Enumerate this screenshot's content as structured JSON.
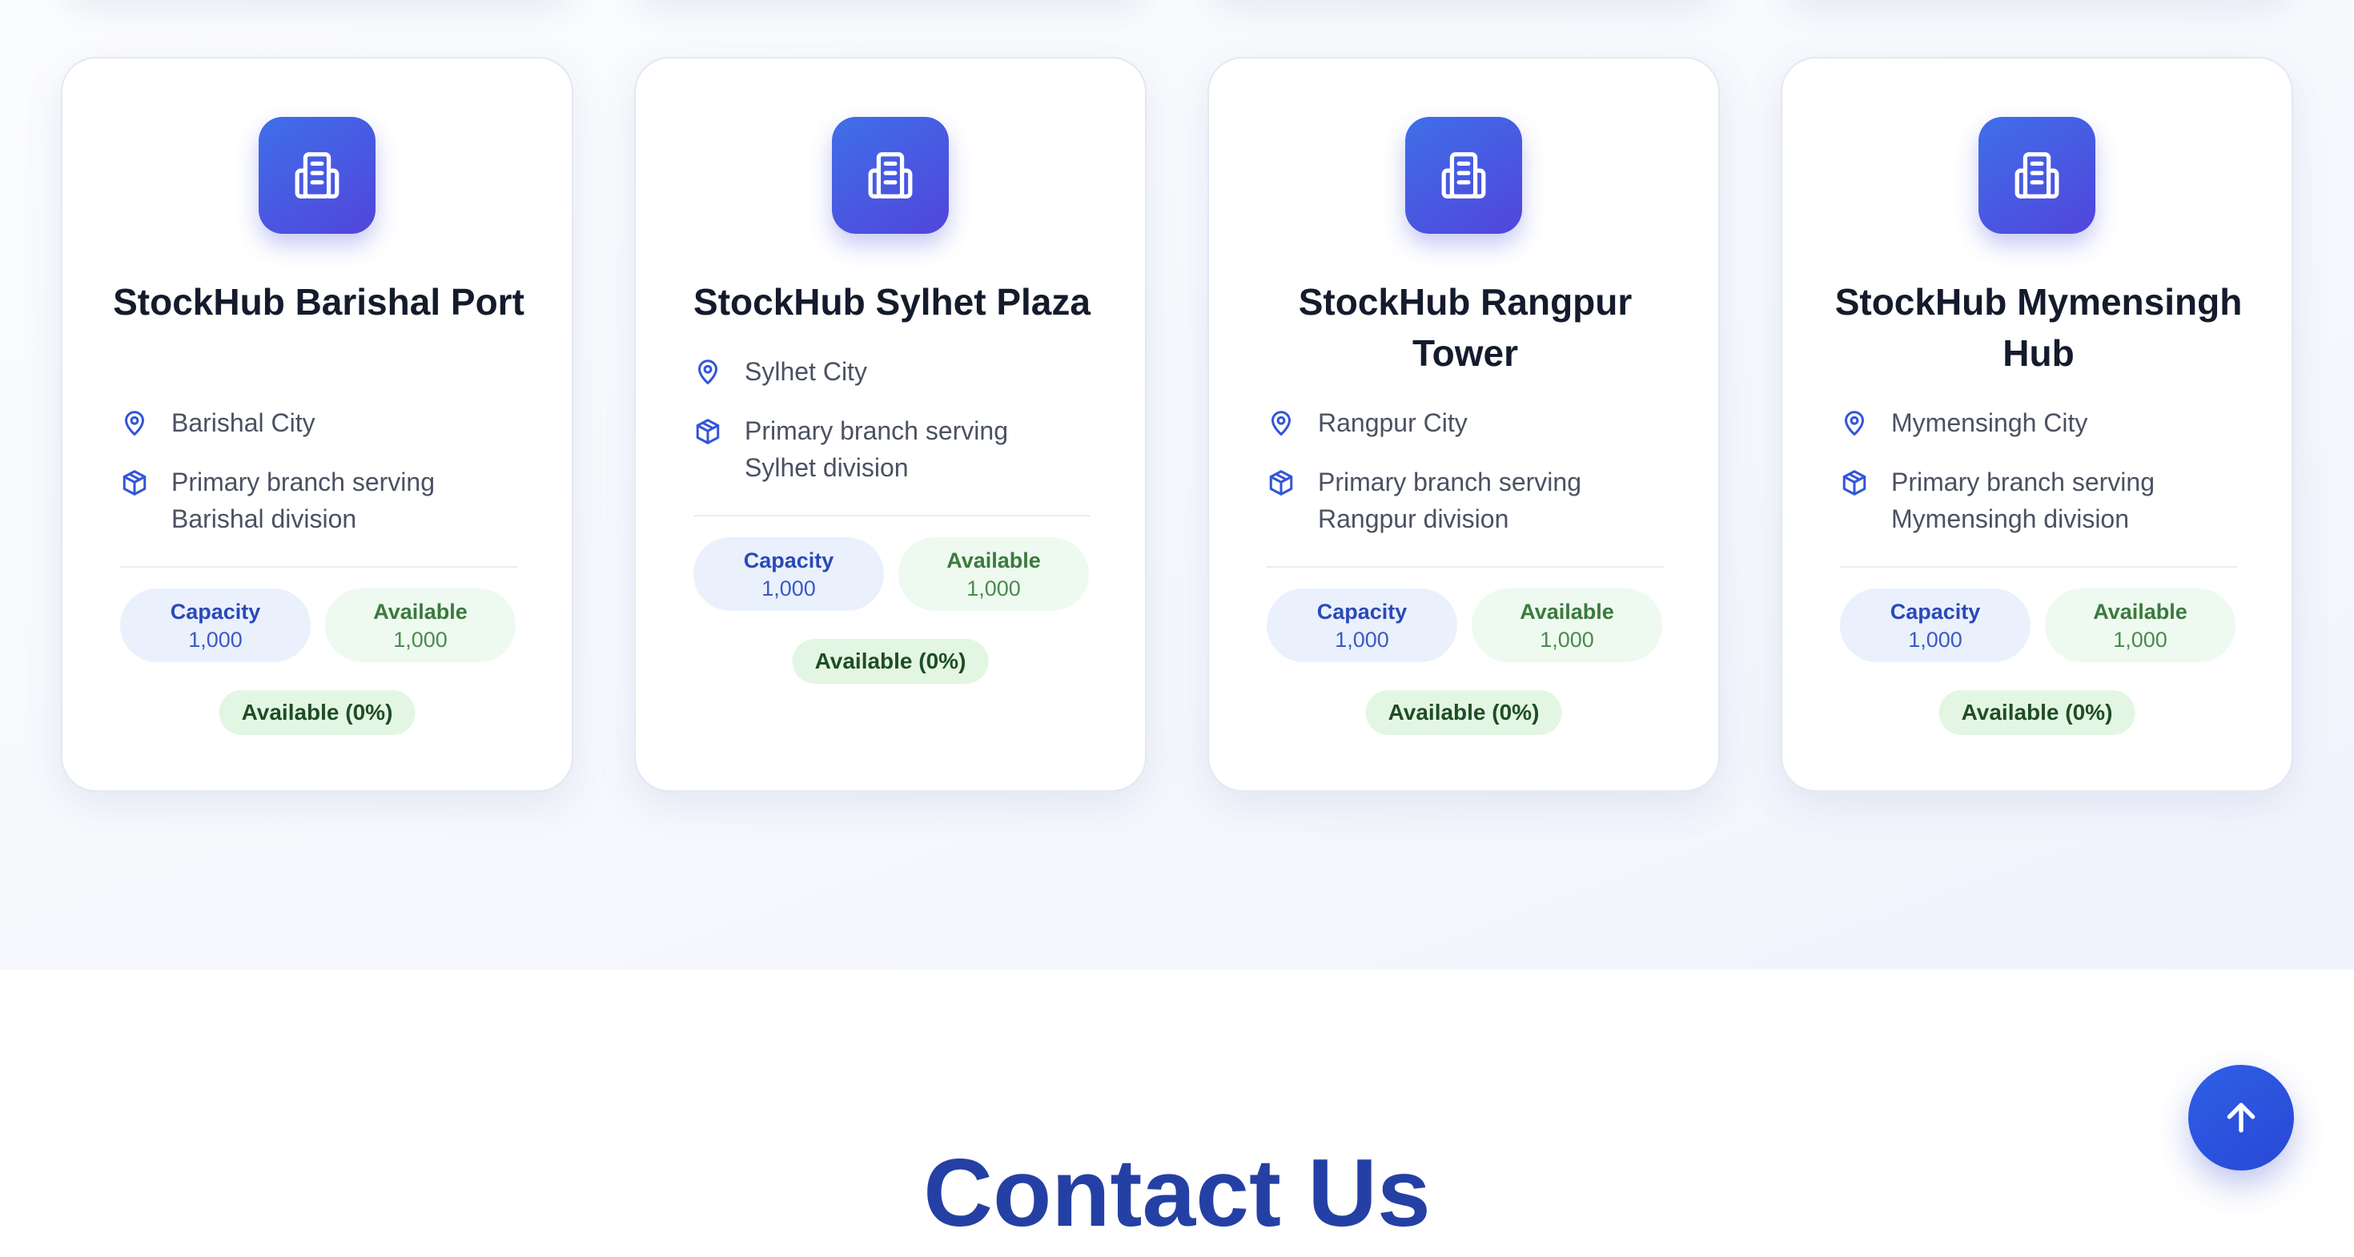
{
  "warehouses": [
    {
      "name": "StockHub Barishal Port",
      "location": "Barishal City",
      "description": "Primary branch serving Barishal division",
      "capacity_label": "Capacity",
      "capacity_value": "1,000",
      "available_label": "Available",
      "available_value": "1,000",
      "status": "Available (0%)"
    },
    {
      "name": "StockHub Sylhet Plaza",
      "location": "Sylhet City",
      "description": "Primary branch serving Sylhet division",
      "capacity_label": "Capacity",
      "capacity_value": "1,000",
      "available_label": "Available",
      "available_value": "1,000",
      "status": "Available (0%)"
    },
    {
      "name": "StockHub Rangpur Tower",
      "location": "Rangpur City",
      "description": "Primary branch serving Rangpur division",
      "capacity_label": "Capacity",
      "capacity_value": "1,000",
      "available_label": "Available",
      "available_value": "1,000",
      "status": "Available (0%)"
    },
    {
      "name": "StockHub Mymensingh Hub",
      "location": "Mymensingh City",
      "description": "Primary branch serving Mymensingh division",
      "capacity_label": "Capacity",
      "capacity_value": "1,000",
      "available_label": "Available",
      "available_value": "1,000",
      "status": "Available (0%)"
    }
  ],
  "icons": {
    "warehouse": "building-icon",
    "location": "map-pin-icon",
    "description": "box-icon",
    "scroll": "arrow-up-icon"
  },
  "contact": {
    "title": "Contact Us"
  },
  "colors": {
    "accent": "#3f6fe8",
    "accent_dark": "#5145db",
    "title": "#141b2c",
    "contact_title": "#2540a4",
    "capacity_bg": "#eaf1fd",
    "available_bg": "#eef9ef",
    "status_bg": "#e3f6e4"
  }
}
